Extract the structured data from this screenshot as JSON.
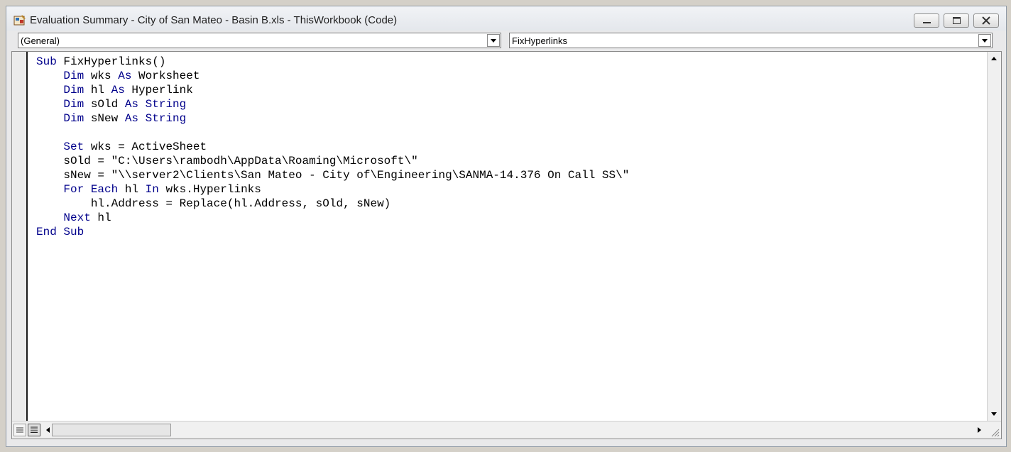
{
  "window": {
    "title": "Evaluation Summary - City of San Mateo - Basin B.xls - ThisWorkbook (Code)",
    "controls": [
      "minimize-icon",
      "maximize-icon",
      "close-icon"
    ]
  },
  "object_dropdown": {
    "selected": "(General)"
  },
  "procedure_dropdown": {
    "selected": "FixHyperlinks"
  },
  "code": {
    "keyword_color": "#00008b",
    "lines": [
      [
        {
          "t": "Sub",
          "k": true
        },
        {
          "t": " FixHyperlinks()"
        }
      ],
      [
        {
          "t": "    "
        },
        {
          "t": "Dim",
          "k": true
        },
        {
          "t": " wks "
        },
        {
          "t": "As",
          "k": true
        },
        {
          "t": " Worksheet"
        }
      ],
      [
        {
          "t": "    "
        },
        {
          "t": "Dim",
          "k": true
        },
        {
          "t": " hl "
        },
        {
          "t": "As",
          "k": true
        },
        {
          "t": " Hyperlink"
        }
      ],
      [
        {
          "t": "    "
        },
        {
          "t": "Dim",
          "k": true
        },
        {
          "t": " sOld "
        },
        {
          "t": "As",
          "k": true
        },
        {
          "t": " "
        },
        {
          "t": "String",
          "k": true
        }
      ],
      [
        {
          "t": "    "
        },
        {
          "t": "Dim",
          "k": true
        },
        {
          "t": " sNew "
        },
        {
          "t": "As",
          "k": true
        },
        {
          "t": " "
        },
        {
          "t": "String",
          "k": true
        }
      ],
      [],
      [
        {
          "t": "    "
        },
        {
          "t": "Set",
          "k": true
        },
        {
          "t": " wks = ActiveSheet"
        }
      ],
      [
        {
          "t": "    sOld = \"C:\\Users\\rambodh\\AppData\\Roaming\\Microsoft\\\""
        }
      ],
      [
        {
          "t": "    sNew = \"\\\\server2\\Clients\\San Mateo - City of\\Engineering\\SANMA-14.376 On Call SS\\\""
        }
      ],
      [
        {
          "t": "    "
        },
        {
          "t": "For",
          "k": true
        },
        {
          "t": " "
        },
        {
          "t": "Each",
          "k": true
        },
        {
          "t": " hl "
        },
        {
          "t": "In",
          "k": true
        },
        {
          "t": " wks.Hyperlinks"
        }
      ],
      [
        {
          "t": "        hl.Address = Replace(hl.Address, sOld, sNew)"
        }
      ],
      [
        {
          "t": "    "
        },
        {
          "t": "Next",
          "k": true
        },
        {
          "t": " hl"
        }
      ],
      [
        {
          "t": "End",
          "k": true
        },
        {
          "t": " "
        },
        {
          "t": "Sub",
          "k": true
        }
      ]
    ]
  }
}
